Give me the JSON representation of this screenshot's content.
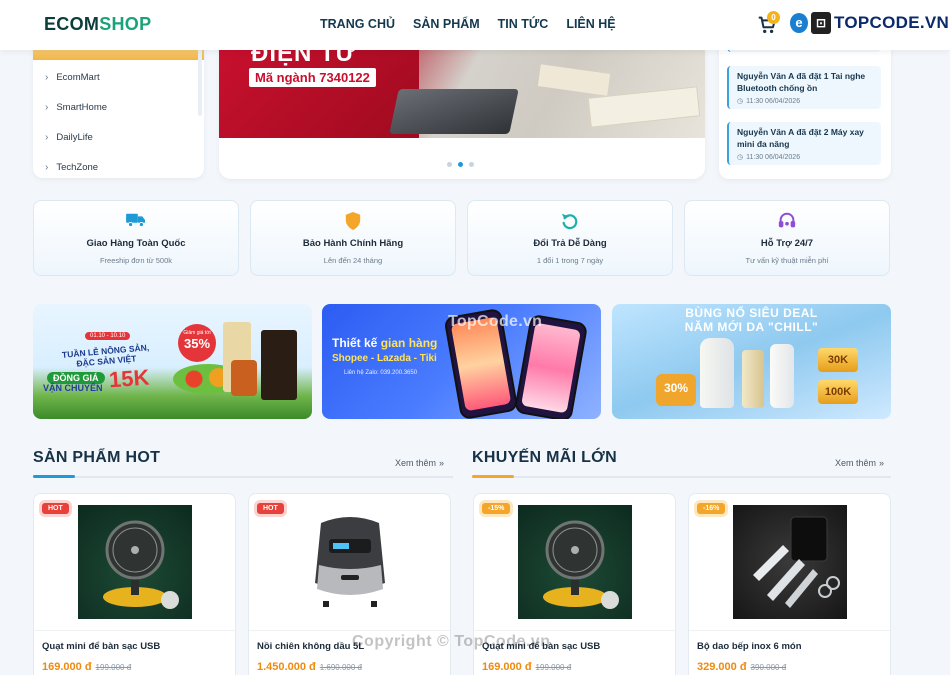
{
  "header": {
    "logo_a": "ECOM",
    "logo_b": "SHOP",
    "nav": [
      "TRANG CHỦ",
      "SẢN PHẨM",
      "TIN TỨC",
      "LIÊN HỆ"
    ],
    "cart_count": "0",
    "watermark_logo": "TOPCODE.VN"
  },
  "sidebar": {
    "categories": [
      "EcomMart",
      "SmartHome",
      "DailyLife",
      "TechZone"
    ]
  },
  "banner": {
    "title": "ĐIỆN TỬ",
    "code": "Mã ngành 7340122",
    "slides": 3,
    "active_slide": 2
  },
  "orders": [
    {
      "text": "Nguyễn Văn A đã đặt 1 Tai nghe Bluetooth chống ồn",
      "time": "11:30 06/04/2026"
    },
    {
      "text": "Nguyễn Văn A đã đặt 2 Máy xay mini đa năng",
      "time": "11:30 06/04/2026"
    }
  ],
  "services": [
    {
      "title": "Giao Hàng Toàn Quốc",
      "sub": "Freeship đơn từ 500k",
      "icon": "truck-icon"
    },
    {
      "title": "Bảo Hành Chính Hãng",
      "sub": "Lên đến 24 tháng",
      "icon": "shield-icon"
    },
    {
      "title": "Đổi Trả Dễ Dàng",
      "sub": "1 đổi 1 trong 7 ngày",
      "icon": "return-icon"
    },
    {
      "title": "Hỗ Trợ 24/7",
      "sub": "Tư vấn kỹ thuật miễn phí",
      "icon": "headset-icon"
    }
  ],
  "promos": {
    "p1": {
      "date": "01.10 - 10.10",
      "week": "TUẦN LỄ NÔNG SẢN, ĐẶC SẢN VIỆT",
      "dong_gia": "ĐỒNG GIÁ",
      "van_chuyen": "VẬN CHUYỂN",
      "price": "15K",
      "discount_label": "Giảm giá tới",
      "discount": "35%"
    },
    "p2": {
      "title_a": "Thiết kế ",
      "title_b": "gian hàng",
      "sub": "Shopee - Lazada - Tiki",
      "contact": "Liên hệ Zalo: 039.200.3650"
    },
    "p3": {
      "title_1": "BÙNG NỔ SIÊU DEAL",
      "title_2": "NĂM MỚI DA \"CHILL\"",
      "tag_a": "30K",
      "tag_b": "100K",
      "discount": "30%"
    }
  },
  "sections": {
    "hot": {
      "title": "SẢN PHẨM HOT",
      "more": "Xem thêm"
    },
    "sale": {
      "title": "KHUYẾN MÃI LỚN",
      "more": "Xem thêm"
    }
  },
  "products": [
    {
      "badge": "HOT",
      "name": "Quạt mini để bàn sạc USB",
      "price": "169.000 đ",
      "old": "199.000 đ"
    },
    {
      "badge": "HOT",
      "name": "Nồi chiên không dầu 5L",
      "price": "1.450.000 đ",
      "old": "1.690.000 đ"
    },
    {
      "badge": "-15%",
      "name": "Quạt mini để bàn sạc USB",
      "price": "169.000 đ",
      "old": "199.000 đ"
    },
    {
      "badge": "-16%",
      "name": "Bộ dao bếp inox 6 món",
      "price": "329.000 đ",
      "old": "390.000 đ"
    }
  ],
  "watermarks": {
    "center": "TopCode.vn",
    "copyright": "Copyright © TopCode.vn"
  },
  "colors": {
    "accent_blue": "#1e9bd7",
    "accent_orange": "#f4a62a",
    "price": "#f08a0c",
    "hot": "#e8403a"
  }
}
